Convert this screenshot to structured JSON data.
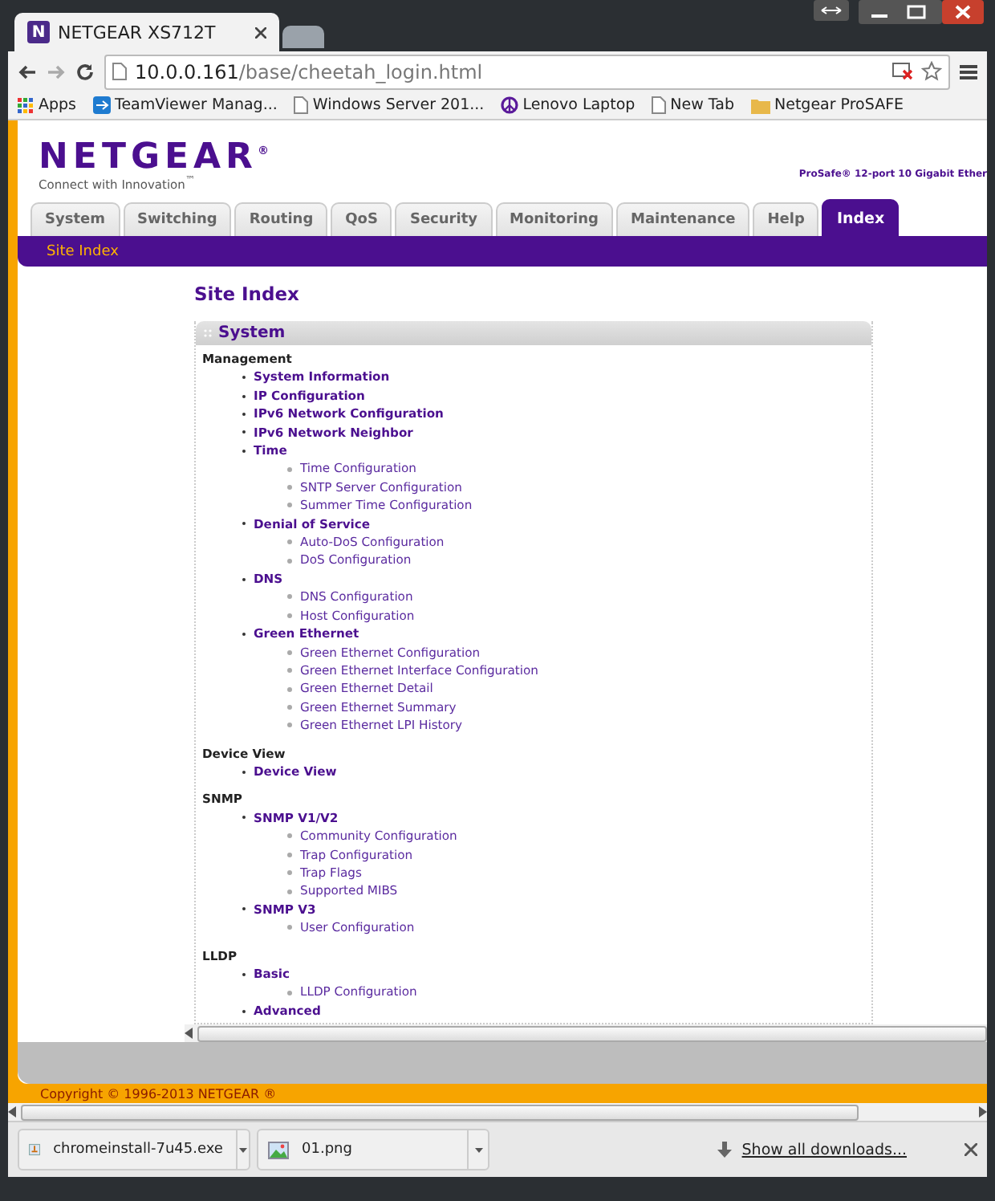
{
  "browser": {
    "tabs": [
      {
        "title": "NETGEAR XS712T",
        "selected": true
      },
      {
        "selected": false
      }
    ],
    "address": {
      "host": "10.0.0.161",
      "path": "/base/cheetah_login.html"
    },
    "bookmarks": [
      {
        "kind": "apps",
        "label": "Apps"
      },
      {
        "kind": "app",
        "label": "TeamViewer Manag..."
      },
      {
        "kind": "page",
        "label": "Windows Server 201..."
      },
      {
        "kind": "peace",
        "label": "Lenovo Laptop"
      },
      {
        "kind": "page",
        "label": "New Tab"
      },
      {
        "kind": "folder",
        "label": "Netgear ProSAFE"
      }
    ]
  },
  "header": {
    "favicon": "N",
    "logo": "NETGEAR",
    "logo_mark": "®",
    "tagline": "Connect with Innovation",
    "tagline_mark": "™",
    "product": "ProSafe® 12-port 10 Gigabit Ether"
  },
  "nav_tabs": [
    {
      "label": "System",
      "selected": false
    },
    {
      "label": "Switching",
      "selected": false
    },
    {
      "label": "Routing",
      "selected": false
    },
    {
      "label": "QoS",
      "selected": false
    },
    {
      "label": "Security",
      "selected": false
    },
    {
      "label": "Monitoring",
      "selected": false
    },
    {
      "label": "Maintenance",
      "selected": false
    },
    {
      "label": "Help",
      "selected": false
    },
    {
      "label": "Index",
      "selected": true
    }
  ],
  "sub_nav": [
    {
      "label": "Site Index",
      "selected": true
    }
  ],
  "page_title": "Site Index",
  "panel": {
    "title": "System",
    "sections": [
      {
        "heading": "Management",
        "items": [
          {
            "label": "System Information"
          },
          {
            "label": "IP Configuration"
          },
          {
            "label": "IPv6 Network Configuration"
          },
          {
            "label": "IPv6 Network Neighbor"
          },
          {
            "label": "Time",
            "children": [
              {
                "label": "Time Configuration"
              },
              {
                "label": "SNTP Server Configuration"
              },
              {
                "label": "Summer Time Configuration"
              }
            ]
          },
          {
            "label": "Denial of Service",
            "children": [
              {
                "label": "Auto-DoS Configuration"
              },
              {
                "label": "DoS Configuration"
              }
            ]
          },
          {
            "label": "DNS",
            "children": [
              {
                "label": "DNS Configuration"
              },
              {
                "label": "Host Configuration"
              }
            ]
          },
          {
            "label": "Green Ethernet",
            "children": [
              {
                "label": "Green Ethernet Configuration"
              },
              {
                "label": "Green Ethernet Interface Configuration"
              },
              {
                "label": "Green Ethernet Detail"
              },
              {
                "label": "Green Ethernet Summary"
              },
              {
                "label": "Green Ethernet LPI History"
              }
            ]
          }
        ]
      },
      {
        "heading": "Device View",
        "items": [
          {
            "label": "Device View"
          }
        ]
      },
      {
        "heading": "SNMP",
        "items": [
          {
            "label": "SNMP V1/V2",
            "children": [
              {
                "label": "Community Configuration"
              },
              {
                "label": "Trap Configuration"
              },
              {
                "label": "Trap Flags"
              },
              {
                "label": "Supported MIBS"
              }
            ]
          },
          {
            "label": "SNMP V3",
            "children": [
              {
                "label": "User Configuration"
              }
            ]
          }
        ]
      },
      {
        "heading": "LLDP",
        "items": [
          {
            "label": "Basic",
            "children": [
              {
                "label": "LLDP Configuration"
              }
            ]
          },
          {
            "label": "Advanced"
          }
        ]
      }
    ]
  },
  "footer": "Copyright © 1996-2013 NETGEAR ®",
  "downloads": [
    {
      "kind": "exe",
      "name": "chromeinstall-7u45.exe"
    },
    {
      "kind": "image",
      "name": "01.png"
    }
  ],
  "show_all": "Show all downloads..."
}
